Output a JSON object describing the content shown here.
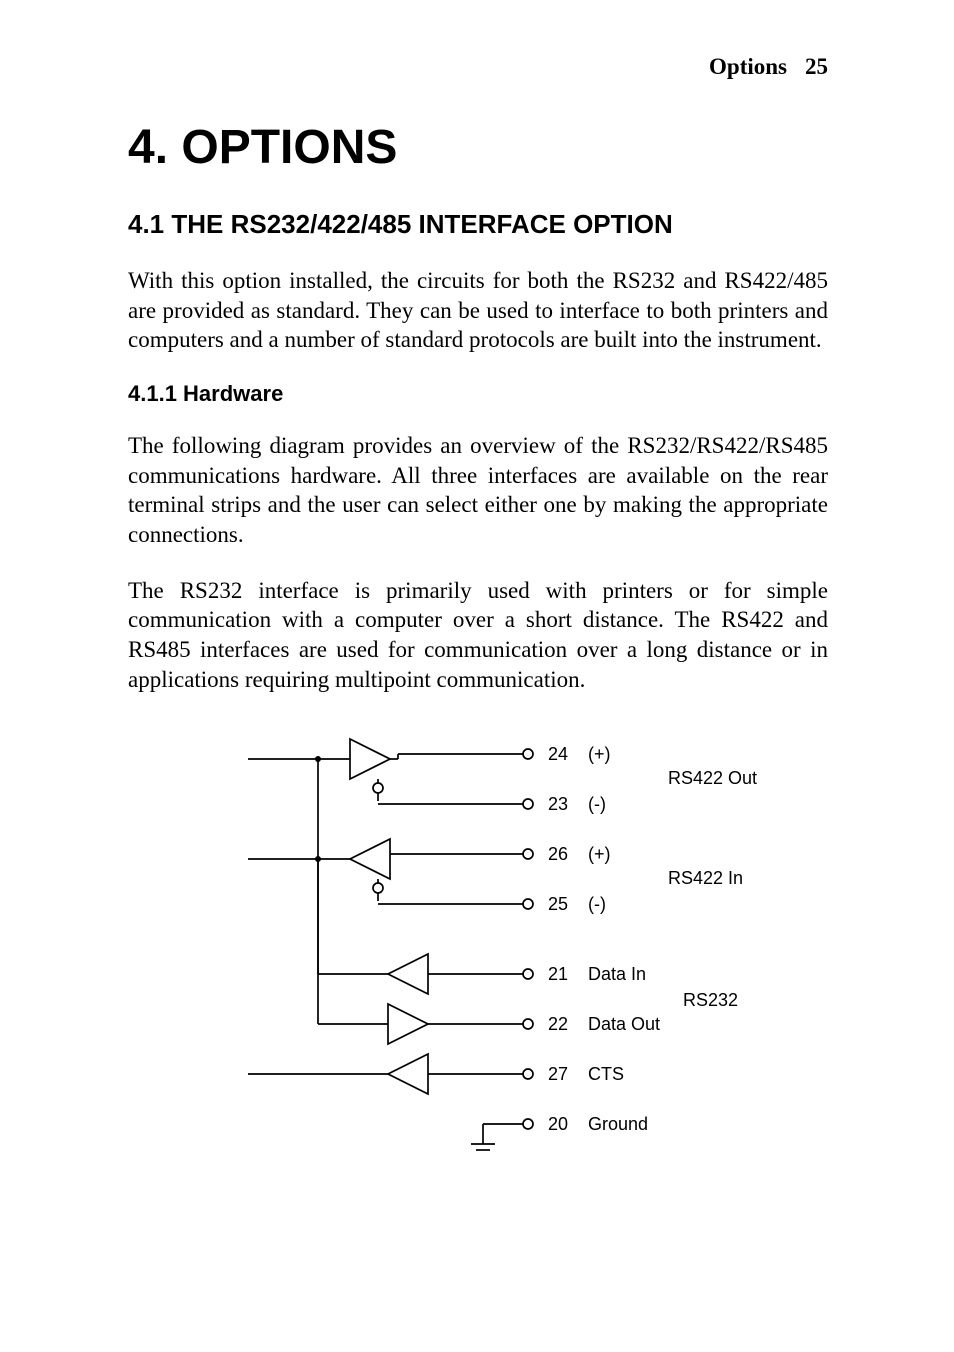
{
  "header": {
    "section_name": "Options",
    "page_number": "25"
  },
  "title": "4. OPTIONS",
  "section_4_1": {
    "heading": "4.1  THE RS232/422/485 INTERFACE OPTION",
    "paragraph": "With this option installed, the circuits for both the RS232 and RS422/485 are provided as standard.  They can be used to interface to both printers and computers and a number of standard protocols are built into the instrument."
  },
  "section_4_1_1": {
    "heading": "4.1.1  Hardware",
    "paragraph1": "The following diagram provides an overview of the RS232/RS422/RS485 communications hardware.  All three interfaces are available on the rear terminal strips and the user can select either one by making the appropriate connections.",
    "paragraph2": "The RS232 interface is primarily used with printers or for simple communication with a computer over a short distance.  The RS422 and RS485 interfaces are used for communication over a long distance or in applications requiring multipoint communication."
  },
  "diagram": {
    "terminals": [
      {
        "pin": "24",
        "signal": "(+)"
      },
      {
        "pin": "23",
        "signal": "(-)"
      },
      {
        "pin": "26",
        "signal": "(+)"
      },
      {
        "pin": "25",
        "signal": "(-)"
      },
      {
        "pin": "21",
        "signal": "Data In"
      },
      {
        "pin": "22",
        "signal": "Data Out"
      },
      {
        "pin": "27",
        "signal": "CTS"
      },
      {
        "pin": "20",
        "signal": "Ground"
      }
    ],
    "groups": {
      "rs422_out": "RS422 Out",
      "rs422_in": "RS422 In",
      "rs232": "RS232"
    }
  }
}
